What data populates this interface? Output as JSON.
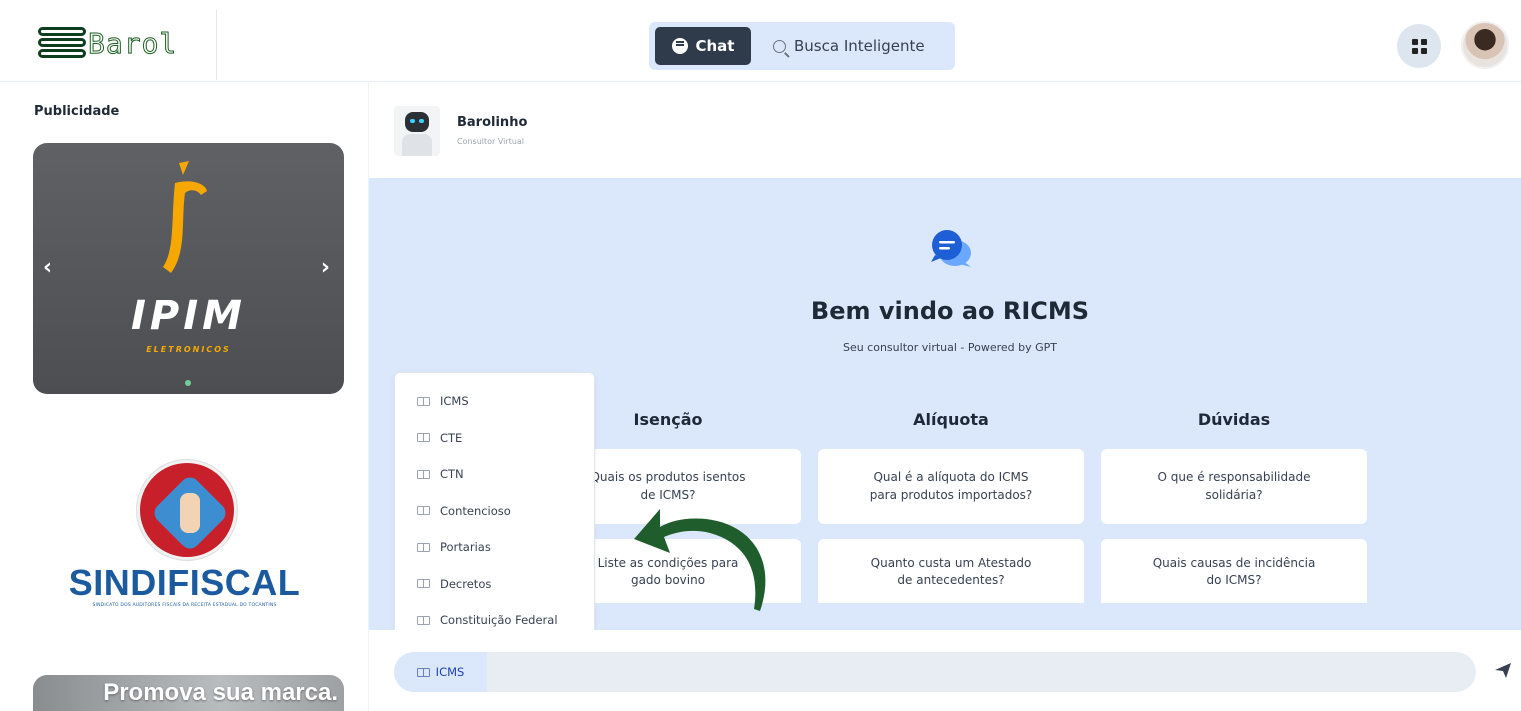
{
  "app": {
    "logo_text": "Barol",
    "mode_switch": {
      "chat_label": "Chat",
      "search_label": "Busca Inteligente"
    }
  },
  "sidebar": {
    "title": "Publicidade",
    "ad_carousel": {
      "brand": "IPIM",
      "tagline": "ELETRONICOS",
      "prev": "‹",
      "next": "›"
    },
    "sindifiscal": {
      "name": "SINDIFISCAL",
      "tagline": "SINDICATO DOS AUDITORES FISCAIS DA RECEITA ESTADUAL DO TOCANTINS"
    },
    "promo": {
      "text": "Promova sua marca."
    }
  },
  "bot": {
    "name": "Barolinho",
    "role": "Consultor Virtual"
  },
  "welcome": {
    "title": "Bem vindo ao RICMS",
    "subtitle": "Seu consultor virtual - Powered by GPT"
  },
  "suggestions": [
    {
      "title": "Isenção",
      "questions": [
        "Quais os produtos isentos de ICMS?",
        "Liste as condições para gado bovino"
      ]
    },
    {
      "title": "Alíquota",
      "questions": [
        "Qual é a alíquota do ICMS para produtos importados?",
        "Quanto custa um Atestado de antecedentes?"
      ]
    },
    {
      "title": "Dúvidas",
      "questions": [
        "O que é responsabilidade solidária?",
        "Quais causas de incidência do ICMS?"
      ]
    }
  ],
  "dropdown": {
    "items": [
      "ICMS",
      "CTE",
      "CTN",
      "Contencioso",
      "Portarias",
      "Decretos",
      "Constituição Federal"
    ]
  },
  "input": {
    "selected_source": "ICMS",
    "value": "",
    "placeholder": ""
  },
  "colors": {
    "accent_dark": "#2f3b4a",
    "chat_bg": "#dbe8fb",
    "brand_green": "#1b5e20",
    "arrow_green": "#1f5e2c"
  }
}
